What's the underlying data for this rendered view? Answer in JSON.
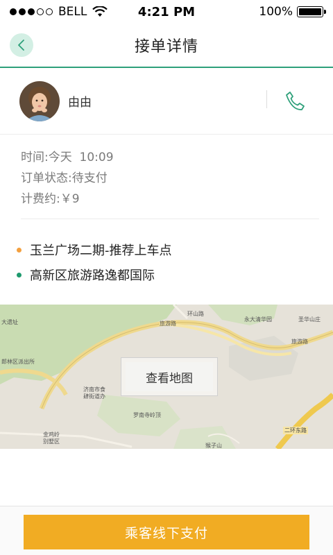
{
  "status_bar": {
    "carrier": "BELL",
    "time": "4:21 PM",
    "battery": "100%",
    "signal_bars_filled": 3,
    "signal_bars_total": 5
  },
  "header": {
    "title": "接单详情",
    "back_icon": "chevron-left-icon"
  },
  "passenger": {
    "name": "由由",
    "call_icon": "phone-icon"
  },
  "order": {
    "time_label": "时间:",
    "time_value": "今天  10:09",
    "status_label": "订单状态:",
    "status_value": "待支付",
    "fare_label": "计费约:",
    "fare_value": "￥9"
  },
  "addresses": {
    "pickup": "玉兰广场二期-推荐上车点",
    "dropoff": "高新区旅游路逸都国际",
    "pickup_color": "#f3a03f",
    "dropoff_color": "#1e9a6e"
  },
  "map": {
    "view_button": "查看地图",
    "labels": [
      "大遗址",
      "环山路",
      "永大清华园",
      "圣华山庄",
      "旅游路",
      "旅游路",
      "郎林区派出所",
      "济南市食",
      "肆街道办",
      "罗南寺岭顶",
      "金鸡岭",
      "别墅区",
      "猴子山",
      "二环东路"
    ]
  },
  "footer": {
    "pay_button": "乘客线下支付"
  },
  "colors": {
    "accent_green": "#2ea07a",
    "pay_orange": "#f1ac23"
  }
}
